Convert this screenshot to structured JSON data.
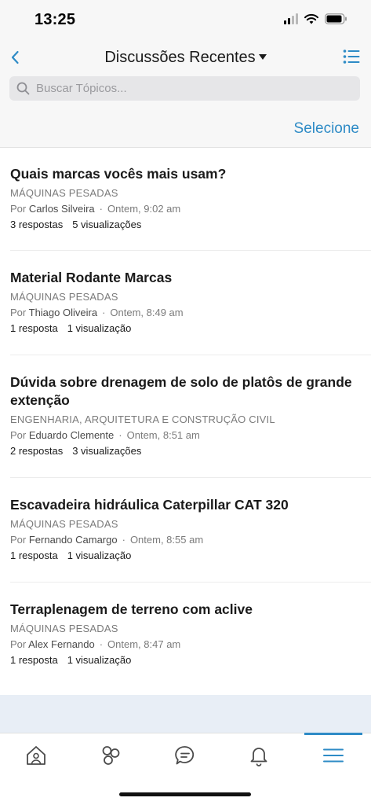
{
  "status_bar": {
    "time": "13:25",
    "icons": [
      "signal-icon",
      "wifi-icon",
      "battery-icon"
    ]
  },
  "header": {
    "back_icon": "chevron-left-icon",
    "title": "Discussões Recentes",
    "title_icon": "caret-down-icon",
    "list_icon": "list-icon",
    "search_placeholder": "Buscar Tópicos...",
    "search_value": "",
    "select_label": "Selecione"
  },
  "topics": [
    {
      "title": "Quais marcas vocês mais usam?",
      "category": "MÁQUINAS PESADAS",
      "by": "Por",
      "author": "Carlos Silveira",
      "time": "Ontem, 9:02 am",
      "replies": "3 respostas",
      "views": "5 visualizações"
    },
    {
      "title": "Material Rodante Marcas",
      "category": "MÁQUINAS PESADAS",
      "by": "Por",
      "author": "Thiago Oliveira",
      "time": "Ontem, 8:49 am",
      "replies": "1 resposta",
      "views": "1 visualização"
    },
    {
      "title": "Dúvida sobre drenagem de solo de platôs de grande extenção",
      "category": "ENGENHARIA, ARQUITETURA E CONSTRUÇÃO CIVIL",
      "by": "Por",
      "author": "Eduardo Clemente",
      "time": "Ontem, 8:51 am",
      "replies": "2 respostas",
      "views": "3 visualizações"
    },
    {
      "title": "Escavadeira hidráulica Caterpillar CAT 320",
      "category": "MÁQUINAS PESADAS",
      "by": "Por",
      "author": "Fernando Camargo",
      "time": "Ontem, 8:55 am",
      "replies": "1 resposta",
      "views": "1 visualização"
    },
    {
      "title": "Terraplenagem de terreno com aclive",
      "category": "MÁQUINAS PESADAS",
      "by": "Por",
      "author": "Alex Fernando",
      "time": "Ontem, 8:47 am",
      "replies": "1 resposta",
      "views": "1 visualização"
    }
  ],
  "tab_bar": {
    "tabs": [
      "home-icon",
      "groups-icon",
      "chat-icon",
      "bell-icon",
      "menu-icon"
    ],
    "active": "menu-icon"
  },
  "colors": {
    "accent": "#2e8bc6",
    "header_bg": "#f7f7f7",
    "text_primary": "#1a1a1a",
    "text_secondary": "#7b7b7b"
  }
}
